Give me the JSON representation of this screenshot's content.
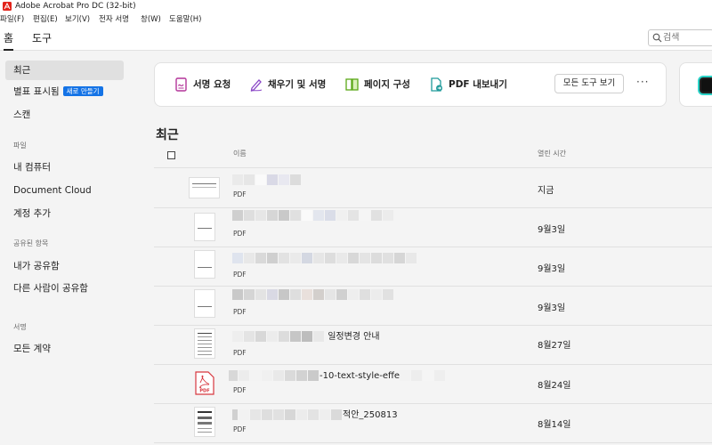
{
  "window": {
    "title": "Adobe Acrobat Pro DC (32-bit)"
  },
  "menu": [
    "파일(F)",
    "편집(E)",
    "보기(V)",
    "전자 서명",
    "창(W)",
    "도움말(H)"
  ],
  "tabs": [
    "홈",
    "도구"
  ],
  "search": {
    "placeholder": "검색"
  },
  "sidebar": {
    "items": [
      {
        "label": "최근",
        "active": true
      },
      {
        "label": "별표 표시됨",
        "badge": "새로 만들기"
      },
      {
        "label": "스캔"
      }
    ],
    "section_files": "파일",
    "file_items": [
      "내 컴퓨터",
      "Document Cloud",
      "계정 추가"
    ],
    "section_shared": "공유된 항목",
    "shared_items": [
      "내가 공유함",
      "다른 사람이 공유함"
    ],
    "section_sign": "서명",
    "sign_items": [
      "모든 계약"
    ]
  },
  "tools": {
    "items": [
      {
        "label": "서명 요청",
        "icon": "request-signature-icon",
        "color": "#b4359a"
      },
      {
        "label": "채우기 및 서명",
        "icon": "fill-sign-pen-icon",
        "color": "#8a47c7"
      },
      {
        "label": "페이지 구성",
        "icon": "organize-pages-icon",
        "color": "#5aa817"
      },
      {
        "label": "PDF 내보내기",
        "icon": "export-pdf-icon",
        "color": "#1f9a9a"
      }
    ],
    "all_tools": "모든 도구 보기",
    "more": "···"
  },
  "recent": {
    "title": "최근",
    "columns": {
      "name": "이름",
      "time": "열린 시간"
    },
    "files": [
      {
        "name": "",
        "type": "PDF",
        "time": "지금"
      },
      {
        "name": "",
        "type": "PDF",
        "time": "9월3일"
      },
      {
        "name": "",
        "type": "PDF",
        "time": "9월3일"
      },
      {
        "name": "",
        "type": "PDF",
        "time": "9월3일"
      },
      {
        "name": "일정변경 안내",
        "type": "PDF",
        "time": "8월27일"
      },
      {
        "name": "-10-text-style-effe",
        "type": "PDF",
        "time": "8월24일"
      },
      {
        "name": "적안_250813",
        "type": "PDF",
        "time": "8월14일"
      }
    ]
  },
  "colors": {
    "accent": "#1473e6",
    "acrobat_red": "#e2231a",
    "pdf_red": "#d7373f"
  }
}
